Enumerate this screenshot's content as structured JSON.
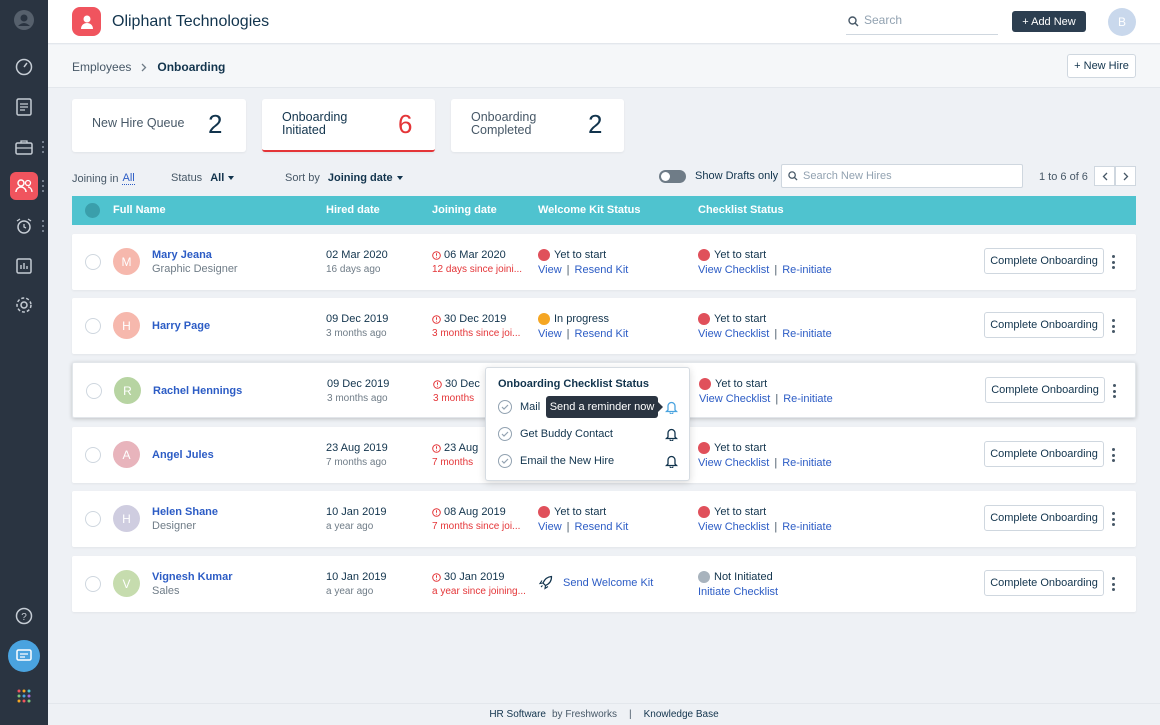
{
  "app": {
    "title": "Oliphant Technologies"
  },
  "header": {
    "search_placeholder": "Search",
    "add_new": "+ Add New",
    "avatar_initial": "B"
  },
  "breadcrumb": {
    "parent": "Employees",
    "current": "Onboarding"
  },
  "new_hire_button": "+ New Hire",
  "cards": [
    {
      "label_1": "New Hire Queue",
      "label_2": "",
      "count": "2"
    },
    {
      "label_1": "Onboarding",
      "label_2": "Initiated",
      "count": "6"
    },
    {
      "label_1": "Onboarding",
      "label_2": "Completed",
      "count": "2"
    }
  ],
  "filters": {
    "joining_label": "Joining in",
    "joining_value": "All",
    "status_label": "Status",
    "status_value": "All",
    "sort_label": "Sort by",
    "sort_value": "Joining date",
    "drafts_label": "Show Drafts only",
    "search_placeholder": "Search New Hires",
    "pagination": "1 to 6 of 6"
  },
  "columns": {
    "name": "Full Name",
    "hired": "Hired date",
    "joining": "Joining date",
    "kit": "Welcome Kit Status",
    "checklist": "Checklist Status"
  },
  "row_action": "Complete Onboarding",
  "rows": [
    {
      "initial": "M",
      "avatar_color": "#f6b8ad",
      "name": "Mary Jeana",
      "role": "Graphic Designer",
      "hired": "02 Mar 2020",
      "hired_ago": "16 days ago",
      "joining": "06 Mar 2020",
      "joining_note": "12 days since joini...",
      "kit_status": "Yet to start",
      "kit_color": "#e0505b",
      "kit_link1": "View",
      "kit_link2": "Resend Kit",
      "check_status": "Yet to start",
      "check_color": "#e0505b",
      "check_link1": "View Checklist",
      "check_link2": "Re-initiate"
    },
    {
      "initial": "H",
      "avatar_color": "#f6b8ad",
      "name": "Harry Page",
      "role": "",
      "hired": "09 Dec 2019",
      "hired_ago": "3 months ago",
      "joining": "30 Dec 2019",
      "joining_note": "3 months since joi...",
      "kit_status": "In progress",
      "kit_color": "#f5a623",
      "kit_link1": "View",
      "kit_link2": "Resend Kit",
      "check_status": "Yet to start",
      "check_color": "#e0505b",
      "check_link1": "View Checklist",
      "check_link2": "Re-initiate"
    },
    {
      "initial": "R",
      "avatar_color": "#b7d4a2",
      "name": "Rachel Hennings",
      "role": "",
      "hired": "09 Dec 2019",
      "hired_ago": "3 months ago",
      "joining": "30 Dec",
      "joining_note": "3 months",
      "kit_status": "",
      "kit_color": "#e0505b",
      "kit_link1": "",
      "kit_link2": "",
      "check_status": "Yet to start",
      "check_color": "#e0505b",
      "check_link1": "View Checklist",
      "check_link2": "Re-initiate"
    },
    {
      "initial": "A",
      "avatar_color": "#e8b4bc",
      "name": "Angel Jules",
      "role": "",
      "hired": "23 Aug 2019",
      "hired_ago": "7 months ago",
      "joining": "23 Aug",
      "joining_note": "7 months",
      "kit_status": "",
      "kit_color": "#e0505b",
      "kit_link1": "",
      "kit_link2": "",
      "check_status": "Yet to start",
      "check_color": "#e0505b",
      "check_link1": "View Checklist",
      "check_link2": "Re-initiate"
    },
    {
      "initial": "H",
      "avatar_color": "#cfcde0",
      "name": "Helen Shane",
      "role": "Designer",
      "hired": "10 Jan 2019",
      "hired_ago": "a year ago",
      "joining": "08 Aug 2019",
      "joining_note": "7 months since joi...",
      "kit_status": "Yet to start",
      "kit_color": "#e0505b",
      "kit_link1": "View",
      "kit_link2": "Resend Kit",
      "check_status": "Yet to start",
      "check_color": "#e0505b",
      "check_link1": "View Checklist",
      "check_link2": "Re-initiate"
    },
    {
      "initial": "V",
      "avatar_color": "#c6dcae",
      "name": "Vignesh Kumar",
      "role": "Sales",
      "hired": "10 Jan 2019",
      "hired_ago": "a year ago",
      "joining": "30 Jan 2019",
      "joining_note": "a year since joining...",
      "kit_status": "",
      "kit_color": "",
      "kit_link1": "Send Welcome Kit",
      "kit_link2": "",
      "check_status": "Not Initiated",
      "check_color": "#a8b3bd",
      "check_link1": "Initiate Checklist",
      "check_link2": ""
    }
  ],
  "popover": {
    "title": "Onboarding Checklist Status",
    "items": [
      "Mail",
      "Get Buddy Contact",
      "Email the New Hire"
    ],
    "tooltip": "Send a reminder now"
  },
  "footer": {
    "brand": "HR Software",
    "by": "by Freshworks",
    "sep": "|",
    "kb": "Knowledge Base"
  },
  "colors": {
    "accent": "#4fc3cf",
    "brand": "#f0545e",
    "sidebar": "#2a3441",
    "link": "#2c5cc5"
  }
}
